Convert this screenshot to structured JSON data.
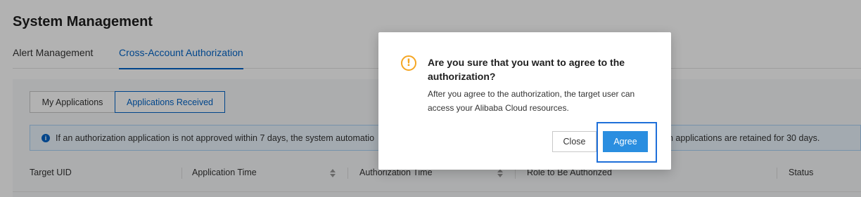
{
  "page": {
    "title": "System Management",
    "tabs": [
      {
        "label": "Alert Management",
        "active": false
      },
      {
        "label": "Cross-Account Authorization",
        "active": true
      }
    ]
  },
  "segments": [
    {
      "label": "My Applications",
      "active": false
    },
    {
      "label": "Applications Received",
      "active": true
    }
  ],
  "notice": {
    "icon": "info-icon",
    "text_left": "If an authorization application is not approved within 7 days, the system automatio",
    "text_right": "on applications are retained for 30 days."
  },
  "table": {
    "columns": [
      {
        "label": "Target UID",
        "sortable": false
      },
      {
        "label": "Application Time",
        "sortable": true
      },
      {
        "label": "Authorization Time",
        "sortable": true
      },
      {
        "label": "Role to Be Authorized",
        "sortable": false
      },
      {
        "label": "Status",
        "sortable": false
      }
    ]
  },
  "dialog": {
    "icon": "warning-icon",
    "icon_color": "#f5a623",
    "title": "Are you sure that you want to agree to the authorization?",
    "body": "After you agree to the authorization, the target user can access your Alibaba Cloud resources.",
    "close_label": "Close",
    "agree_label": "Agree"
  },
  "colors": {
    "accent": "#0064c8",
    "primary_button": "#2a8ee0",
    "highlight": "#1e6fd9"
  }
}
